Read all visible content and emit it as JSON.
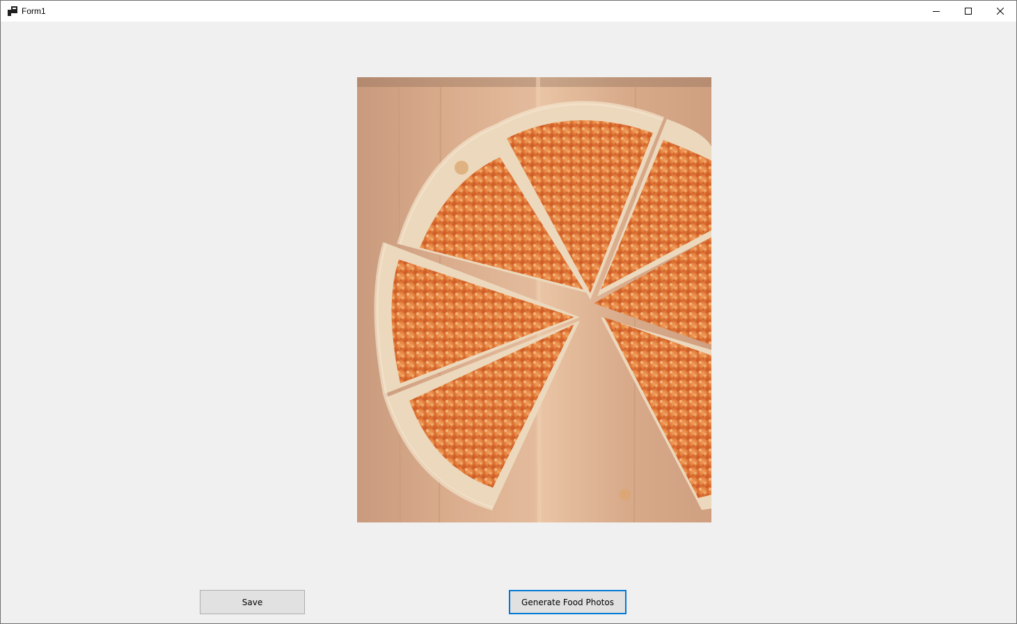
{
  "window": {
    "title": "Form1",
    "icons": {
      "app": "form-app-icon",
      "minimize": "minimize-icon",
      "maximize": "maximize-icon",
      "close": "close-icon"
    }
  },
  "picture": {
    "subject": "pizza-slices-on-wood-board-photo"
  },
  "buttons": {
    "save_label": "Save",
    "generate_label": "Generate Food Photos"
  },
  "colors": {
    "window_bg": "#f0f0f0",
    "titlebar_bg": "#ffffff",
    "button_bg": "#e1e1e1",
    "focus_border": "#0078d7"
  }
}
